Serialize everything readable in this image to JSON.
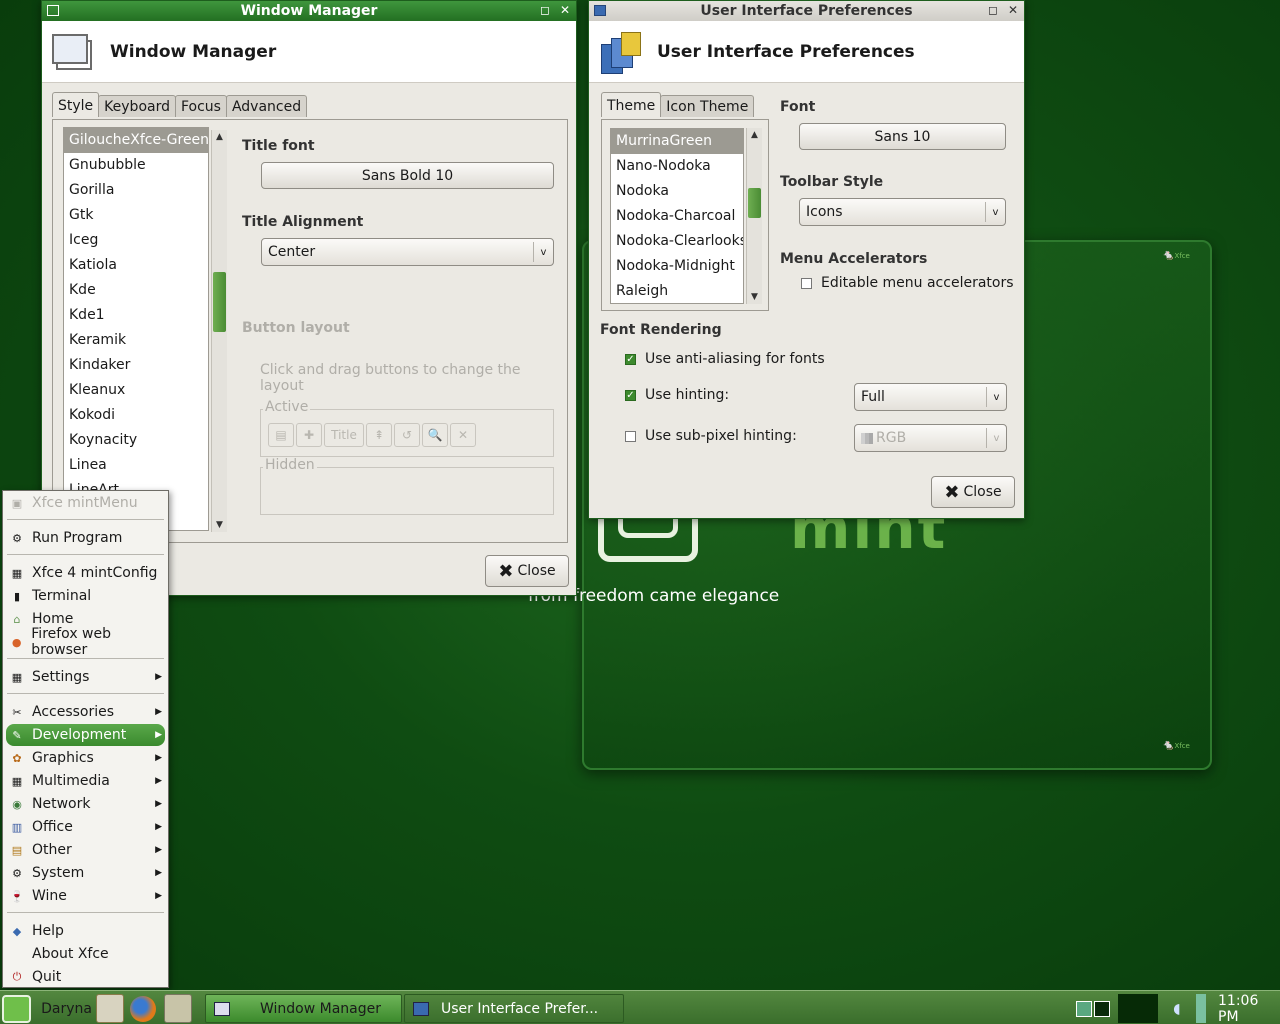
{
  "desktop": {
    "logo_word": "mint",
    "tagline": "from freedom came elegance",
    "mouse_label": "Xfce"
  },
  "wm": {
    "window_title": "Window Manager",
    "header_title": "Window Manager",
    "tabs": [
      "Style",
      "Keyboard",
      "Focus",
      "Advanced"
    ],
    "themes": [
      "GiloucheXfce-Green",
      "Gnububble",
      "Gorilla",
      "Gtk",
      "Iceg",
      "Katiola",
      "Kde",
      "Kde1",
      "Keramik",
      "Kindaker",
      "Kleanux",
      "Kokodi",
      "Koynacity",
      "Linea",
      "LineArt"
    ],
    "title_font_label": "Title font",
    "title_font_value": "Sans Bold 10",
    "title_alignment_label": "Title Alignment",
    "title_alignment_value": "Center",
    "button_layout_label": "Button layout",
    "button_layout_hint": "Click and drag buttons to change the layout",
    "active_label": "Active",
    "hidden_label": "Hidden",
    "title_button": "Title",
    "close_label": "Close"
  },
  "uip": {
    "window_title": "User Interface Preferences",
    "header_title": "User Interface Preferences",
    "tabs": [
      "Theme",
      "Icon Theme"
    ],
    "themes": [
      "MurrinaGreen",
      "Nano-Nodoka",
      "Nodoka",
      "Nodoka-Charcoal",
      "Nodoka-Clearlooks",
      "Nodoka-Midnight",
      "Raleigh"
    ],
    "font_label": "Font",
    "font_value": "Sans 10",
    "toolbar_style_label": "Toolbar Style",
    "toolbar_style_value": "Icons",
    "menu_accel_label": "Menu Accelerators",
    "editable_accel": "Editable menu accelerators",
    "font_rendering_label": "Font Rendering",
    "anti_aliasing": "Use anti-aliasing for fonts",
    "hinting": "Use hinting:",
    "hinting_value": "Full",
    "subpixel": "Use sub-pixel hinting:",
    "subpixel_value": "RGB",
    "close_label": "Close"
  },
  "menu": {
    "header": "Xfce mintMenu",
    "items": [
      {
        "label": "Run Program",
        "icon": "gear-icon"
      },
      {
        "label": "Xfce 4 mintConfig",
        "icon": "config-icon"
      },
      {
        "label": "Terminal",
        "icon": "terminal-icon"
      },
      {
        "label": "Home",
        "icon": "home-icon"
      },
      {
        "label": "Firefox web browser",
        "icon": "firefox-icon"
      },
      {
        "label": "Settings",
        "icon": "settings-icon"
      },
      {
        "label": "Accessories",
        "icon": "accessories-icon"
      },
      {
        "label": "Development",
        "icon": "development-icon"
      },
      {
        "label": "Graphics",
        "icon": "graphics-icon"
      },
      {
        "label": "Multimedia",
        "icon": "multimedia-icon"
      },
      {
        "label": "Network",
        "icon": "network-icon"
      },
      {
        "label": "Office",
        "icon": "office-icon"
      },
      {
        "label": "Other",
        "icon": "other-icon"
      },
      {
        "label": "System",
        "icon": "system-icon"
      },
      {
        "label": "Wine",
        "icon": "wine-icon"
      },
      {
        "label": "Help",
        "icon": "help-icon"
      },
      {
        "label": "About Xfce",
        "icon": "about-icon"
      },
      {
        "label": "Quit",
        "icon": "quit-icon"
      }
    ]
  },
  "taskbar": {
    "start_label": "Daryna",
    "tasks": [
      "Window Manager",
      "User Interface Prefer..."
    ],
    "clock": "11:06 PM"
  },
  "colors": {
    "accent": "#3d8a2e",
    "selection": "#9c9a92",
    "titlebar_active": "#2f8030"
  }
}
